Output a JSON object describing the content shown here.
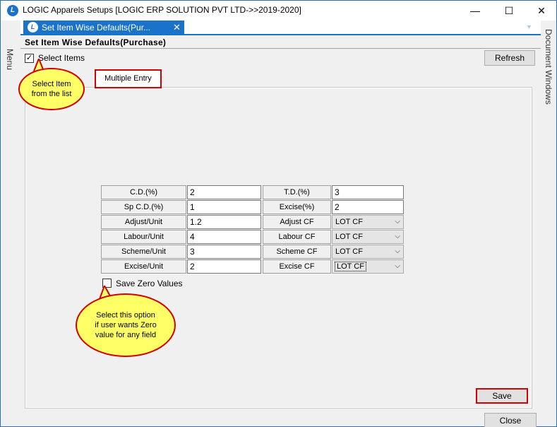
{
  "window": {
    "title": "LOGIC Apparels Setups  [LOGIC ERP SOLUTION PVT LTD->>2019-2020]",
    "app_icon_letter": "L",
    "minimize": "—",
    "maximize": "☐",
    "close": "✕"
  },
  "side": {
    "left_label": "Menu",
    "right_label": "Document Windows"
  },
  "doc_tab": {
    "label": "Set Item Wise Defaults(Pur...",
    "icon_letter": "L",
    "close": "✕",
    "dropdown": "▼"
  },
  "form": {
    "title": "Set Item Wise Defaults(Purchase)",
    "select_items": {
      "label": "Select Items",
      "checked": true,
      "mark": "✓"
    },
    "refresh_label": "Refresh",
    "subtab_label": "Multiple Entry",
    "save_zero": {
      "label": "Save Zero Values",
      "checked": false
    },
    "save_label": "Save",
    "close_label": "Close"
  },
  "grid": {
    "left": [
      {
        "label": "C.D.(%)",
        "value": "2"
      },
      {
        "label": "Sp C.D.(%)",
        "value": "1"
      },
      {
        "label": "Adjust/Unit",
        "value": "1.2"
      },
      {
        "label": "Labour/Unit",
        "value": "4"
      },
      {
        "label": "Scheme/Unit",
        "value": "3"
      },
      {
        "label": "Excise/Unit",
        "value": "2"
      }
    ],
    "right": [
      {
        "label": "T.D.(%)",
        "value": "3"
      },
      {
        "label": "Excise(%)",
        "value": "2"
      },
      {
        "label": "Adjust CF",
        "value": "LOT CF"
      },
      {
        "label": "Labour CF",
        "value": "LOT CF"
      },
      {
        "label": "Scheme CF",
        "value": "LOT CF"
      },
      {
        "label": "Excise CF",
        "value": "LOT CF"
      }
    ],
    "chevron": "⌵"
  },
  "callouts": {
    "select_item": "Select  Item from  the  list",
    "save_zero": "Select  this  option if  user  wants Zero  value  for any  field"
  },
  "colors": {
    "accent": "#1a73c9",
    "highlight_border": "#d40000",
    "callout_fill": "#ffff66"
  }
}
